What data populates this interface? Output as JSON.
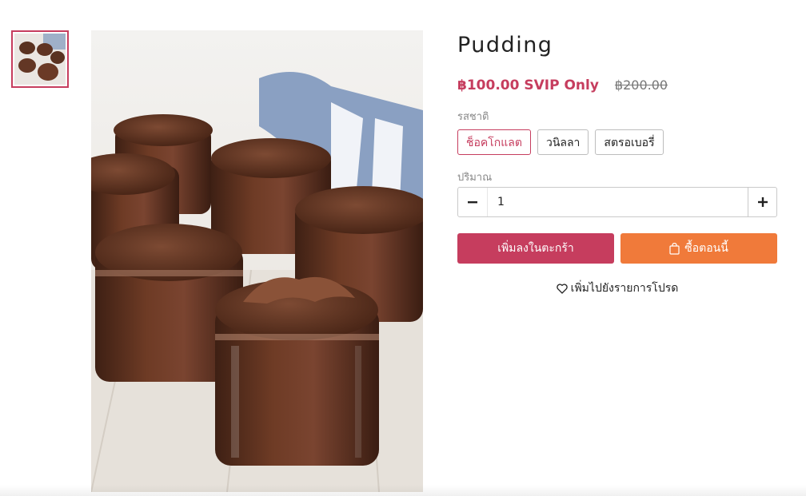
{
  "product": {
    "title": "Pudding",
    "price": "฿100.00 SVIP Only",
    "old_price": "฿200.00",
    "image_alt": "chocolate pudding jars"
  },
  "options": {
    "flavor_label": "รสชาติ",
    "flavors": [
      "ช็อคโกแลต",
      "วนิลลา",
      "สตรอเบอรี่"
    ],
    "selected_flavor": "ช็อคโกแลต"
  },
  "quantity": {
    "label": "ปริมาณ",
    "value": "1",
    "minus_icon": "minus-icon",
    "plus_icon": "plus-icon"
  },
  "actions": {
    "add_to_cart": "เพิ่มลงในตะกร้า",
    "buy_now": "ซื้อตอนนี้",
    "buy_now_icon": "shopping-bag-icon",
    "wishlist": "เพิ่มไปยังรายการโปรด",
    "wishlist_icon": "heart-icon"
  },
  "colors": {
    "accent": "#c63d5e",
    "buy_now": "#f07a3a"
  }
}
